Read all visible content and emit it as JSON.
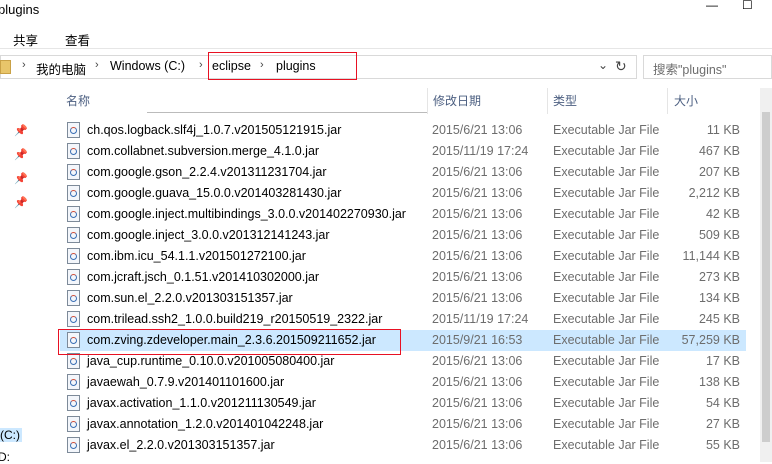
{
  "window": {
    "title": "plugins",
    "controls": {
      "minimize": "—",
      "maximize": "☐",
      "close": "✕"
    }
  },
  "ribbon": {
    "tabs": [
      {
        "label": "共享"
      },
      {
        "label": "查看"
      }
    ]
  },
  "address": {
    "breadcrumbs": [
      {
        "label": "我的电脑"
      },
      {
        "label": "Windows (C:)"
      },
      {
        "label": "eclipse"
      },
      {
        "label": "plugins"
      }
    ],
    "refresh_icon": "↻",
    "dropdown_icon": "⌄"
  },
  "search": {
    "placeholder": "搜索\"plugins\""
  },
  "nav": {
    "drives": [
      {
        "label": "(C:)"
      },
      {
        "label": "e (D:"
      }
    ]
  },
  "columns": {
    "name": "名称",
    "date": "修改日期",
    "type": "类型",
    "size": "大小"
  },
  "files": [
    {
      "name": "ch.qos.logback.slf4j_1.0.7.v201505121915.jar",
      "date": "2015/6/21 13:06",
      "type": "Executable Jar File",
      "size": "11 KB"
    },
    {
      "name": "com.collabnet.subversion.merge_4.1.0.jar",
      "date": "2015/11/19 17:24",
      "type": "Executable Jar File",
      "size": "467 KB"
    },
    {
      "name": "com.google.gson_2.2.4.v201311231704.jar",
      "date": "2015/6/21 13:06",
      "type": "Executable Jar File",
      "size": "207 KB"
    },
    {
      "name": "com.google.guava_15.0.0.v201403281430.jar",
      "date": "2015/6/21 13:06",
      "type": "Executable Jar File",
      "size": "2,212 KB"
    },
    {
      "name": "com.google.inject.multibindings_3.0.0.v201402270930.jar",
      "date": "2015/6/21 13:06",
      "type": "Executable Jar File",
      "size": "42 KB"
    },
    {
      "name": "com.google.inject_3.0.0.v201312141243.jar",
      "date": "2015/6/21 13:06",
      "type": "Executable Jar File",
      "size": "509 KB"
    },
    {
      "name": "com.ibm.icu_54.1.1.v201501272100.jar",
      "date": "2015/6/21 13:06",
      "type": "Executable Jar File",
      "size": "11,144 KB"
    },
    {
      "name": "com.jcraft.jsch_0.1.51.v201410302000.jar",
      "date": "2015/6/21 13:06",
      "type": "Executable Jar File",
      "size": "273 KB"
    },
    {
      "name": "com.sun.el_2.2.0.v201303151357.jar",
      "date": "2015/6/21 13:06",
      "type": "Executable Jar File",
      "size": "134 KB"
    },
    {
      "name": "com.trilead.ssh2_1.0.0.build219_r20150519_2322.jar",
      "date": "2015/11/19 17:24",
      "type": "Executable Jar File",
      "size": "245 KB"
    },
    {
      "name": "com.zving.zdeveloper.main_2.3.6.201509211652.jar",
      "date": "2015/9/21 16:53",
      "type": "Executable Jar File",
      "size": "57,259 KB",
      "selected": true
    },
    {
      "name": "java_cup.runtime_0.10.0.v201005080400.jar",
      "date": "2015/6/21 13:06",
      "type": "Executable Jar File",
      "size": "17 KB"
    },
    {
      "name": "javaewah_0.7.9.v201401101600.jar",
      "date": "2015/6/21 13:06",
      "type": "Executable Jar File",
      "size": "138 KB"
    },
    {
      "name": "javax.activation_1.1.0.v201211130549.jar",
      "date": "2015/6/21 13:06",
      "type": "Executable Jar File",
      "size": "54 KB"
    },
    {
      "name": "javax.annotation_1.2.0.v201401042248.jar",
      "date": "2015/6/21 13:06",
      "type": "Executable Jar File",
      "size": "27 KB"
    },
    {
      "name": "javax.el_2.2.0.v201303151357.jar",
      "date": "2015/6/21 13:06",
      "type": "Executable Jar File",
      "size": "55 KB"
    }
  ],
  "colors": {
    "selection": "#cce8ff",
    "highlight_border": "#e81123",
    "header_text": "#4d6082"
  }
}
